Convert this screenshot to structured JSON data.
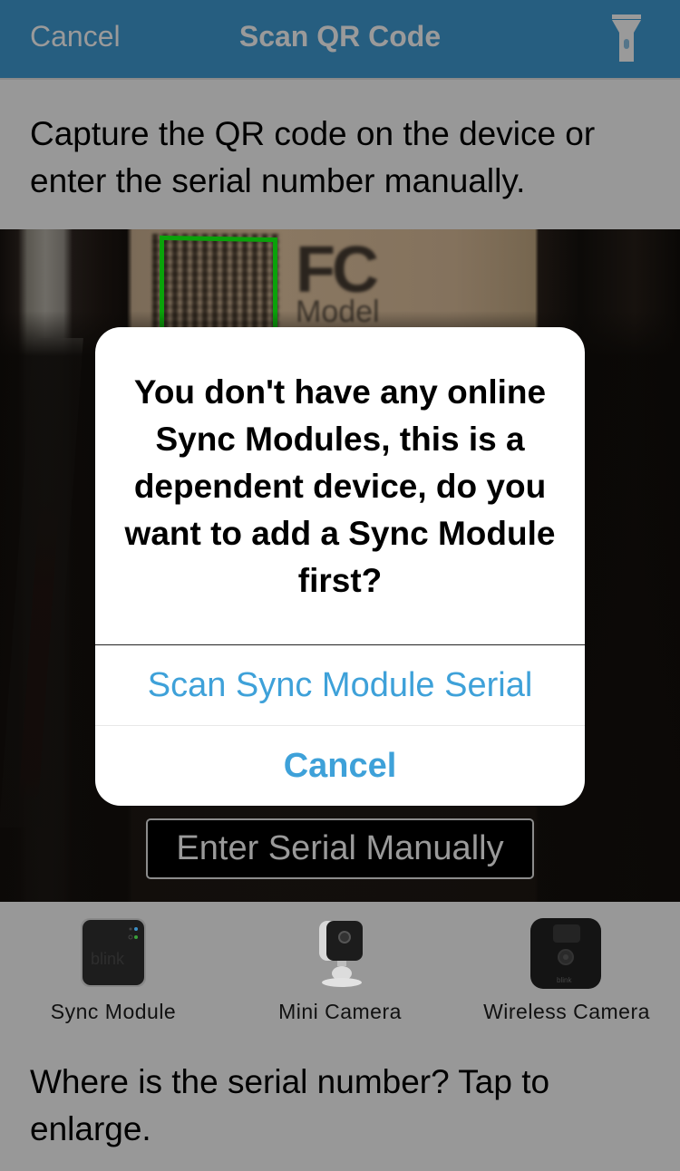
{
  "navbar": {
    "cancel_label": "Cancel",
    "title": "Scan QR Code",
    "flashlight_icon": "flashlight-icon",
    "background_color": "#265e80",
    "text_color": "#9a9a9a"
  },
  "instruction": {
    "text": "Capture the QR code on the device or enter the serial number manually."
  },
  "camera_preview": {
    "label_text_fc": "FC",
    "label_text_model": "Model",
    "qr_frame_color": "#0aa20a"
  },
  "enter_serial_button": {
    "label": "Enter Serial Manually"
  },
  "devices": [
    {
      "label": "Sync Module",
      "icon": "sync-module-icon"
    },
    {
      "label": "Mini Camera",
      "icon": "mini-camera-icon"
    },
    {
      "label": "Wireless Camera",
      "icon": "wireless-camera-icon"
    }
  ],
  "bottom_help": {
    "text": "Where is the serial number? Tap to enlarge."
  },
  "alert": {
    "message": "You don't have any online Sync Modules, this is a dependent device, do you want to add a Sync Module first?",
    "primary_button": "Scan Sync Module Serial",
    "cancel_button": "Cancel",
    "button_color": "#3ea1d9"
  }
}
